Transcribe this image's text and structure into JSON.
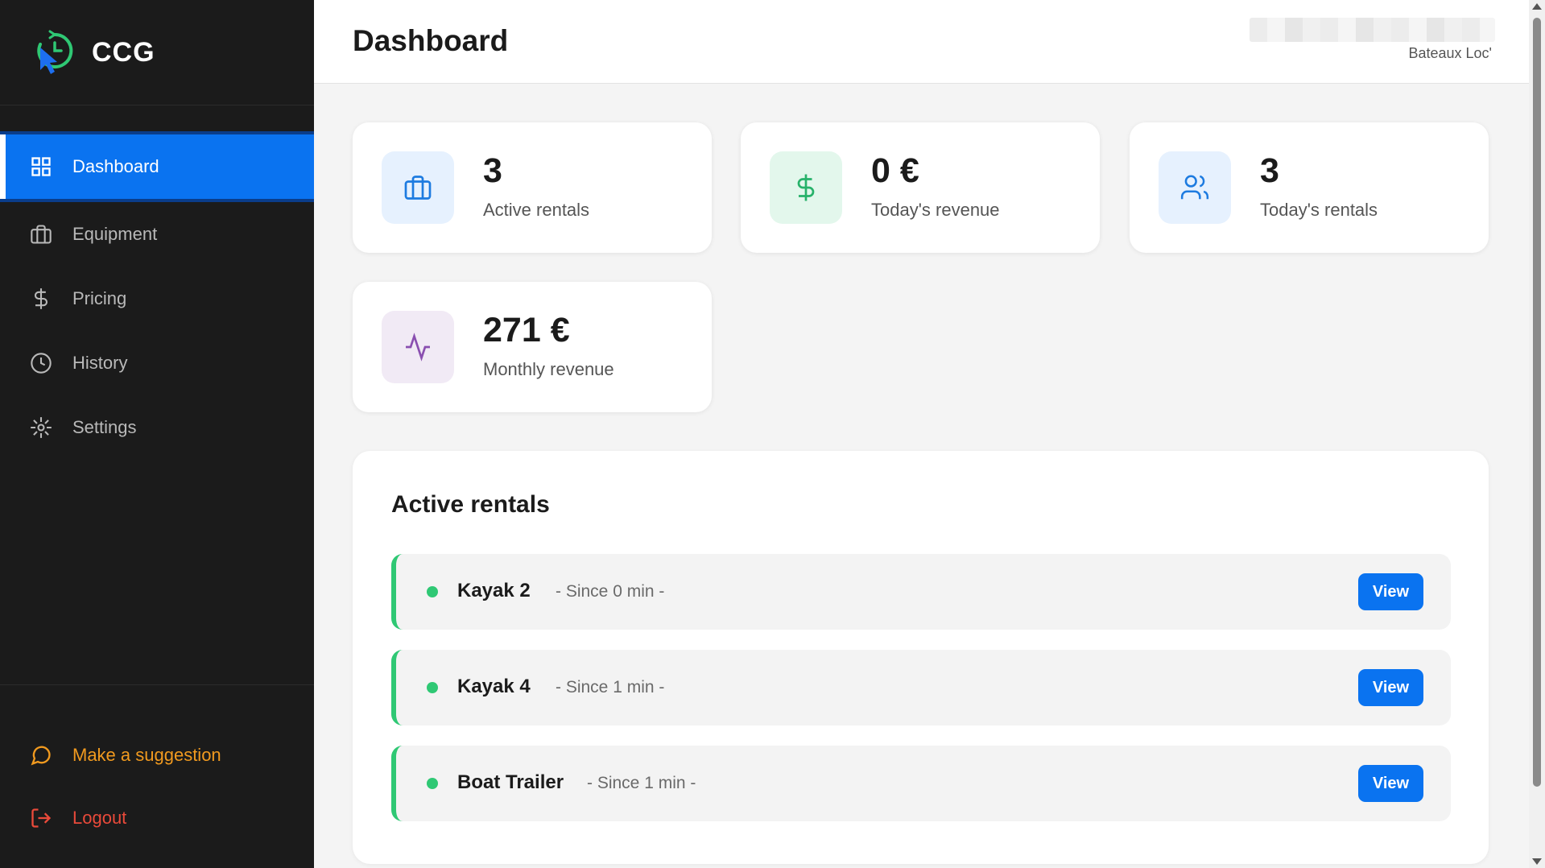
{
  "brand": {
    "name": "CCG"
  },
  "sidebar": {
    "items": [
      {
        "label": "Dashboard",
        "icon": "grid-icon",
        "active": true
      },
      {
        "label": "Equipment",
        "icon": "briefcase-icon"
      },
      {
        "label": "Pricing",
        "icon": "dollar-icon"
      },
      {
        "label": "History",
        "icon": "clock-icon"
      },
      {
        "label": "Settings",
        "icon": "gear-icon"
      }
    ],
    "footer": {
      "suggestion": "Make a suggestion",
      "logout": "Logout"
    }
  },
  "header": {
    "title": "Dashboard",
    "company": "Bateaux Loc'"
  },
  "stats": [
    {
      "value": "3",
      "label": "Active rentals",
      "icon": "briefcase-icon",
      "color": "#1d7be0",
      "bg": "#e6f1fe"
    },
    {
      "value": "0 €",
      "label": "Today's revenue",
      "icon": "dollar-icon",
      "color": "#27b26a",
      "bg": "#e3f7ec"
    },
    {
      "value": "3",
      "label": "Today's rentals",
      "icon": "users-icon",
      "color": "#1d7be0",
      "bg": "#e6f1fe"
    },
    {
      "value": "271 €",
      "label": "Monthly revenue",
      "icon": "activity-icon",
      "color": "#8a4fb0",
      "bg": "#f1eaf5"
    }
  ],
  "active_rentals": {
    "title": "Active rentals",
    "button_label": "View",
    "items": [
      {
        "name": "Kayak 2",
        "since": "- Since 0 min -"
      },
      {
        "name": "Kayak 4",
        "since": "- Since 1 min -"
      },
      {
        "name": "Boat Trailer",
        "since": "- Since 1 min -"
      }
    ]
  },
  "colors": {
    "accent": "#0a73f0",
    "sidebar_bg": "#1b1b1b",
    "success": "#2fc874",
    "warning": "#f19a1f",
    "danger": "#ea4a3a"
  }
}
